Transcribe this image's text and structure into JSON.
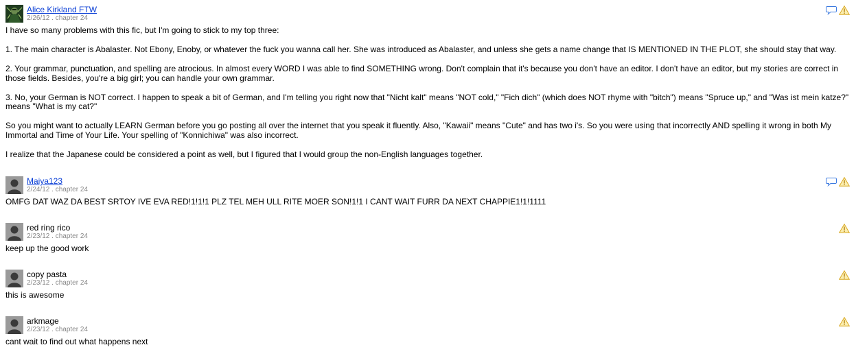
{
  "reviews": [
    {
      "author": "Alice Kirkland FTW",
      "meta": "2/26/12 . chapter 24",
      "paragraphs": [
        "I have so many problems with this fic, but I'm going to stick to my top three:",
        "1. The main character is Abalaster. Not Ebony, Enoby, or whatever the fuck you wanna call her. She was introduced as Abalaster, and unless she gets a name change that IS MENTIONED IN THE PLOT, she should stay that way.",
        "2. Your grammar, punctuation, and spelling are atrocious. In almost every WORD I was able to find SOMETHING wrong. Don't complain that it's because you don't have an editor. I don't have an editor, but my stories are correct in those fields. Besides, you're a big girl; you can handle your own grammar.",
        "3. No, your German is NOT correct. I happen to speak a bit of German, and I'm telling you right now that \"Nicht kalt\" means \"NOT cold,\" \"Fich dich\" (which does NOT rhyme with \"bitch\") means \"Spruce up,\" and \"Was ist mein katze?\" means \"What is my cat?\"",
        "So you might want to actually LEARN German before you go posting all over the internet that you speak it fluently. Also, \"Kawaii\" means \"Cute\" and has two i's. So you were using that incorrectly AND spelling it wrong in both My Immortal and Time of Your Life. Your spelling of \"Konnichiwa\" was also incorrect.",
        "I realize that the Japanese could be considered a point as well, but I figured that I would group the non-English languages together."
      ]
    },
    {
      "author": "Maiya123",
      "meta": "2/24/12 . chapter 24",
      "paragraphs": [
        "OMFG DAT WAZ DA BEST SRTOY IVE EVA RED!1!1!1 PLZ TEL MEH ULL RITE MOER SON!1!1 I CANT WAIT FURR DA NEXT CHAPPIE1!1!1111"
      ]
    },
    {
      "author": "red ring rico",
      "meta": "2/23/12 . chapter 24",
      "paragraphs": [
        "keep up the good work"
      ]
    },
    {
      "author": "copy pasta",
      "meta": "2/23/12 . chapter 24",
      "paragraphs": [
        "this is awesome"
      ]
    },
    {
      "author": "arkmage",
      "meta": "2/23/12 . chapter 24",
      "paragraphs": [
        "cant wait to find out what happens next"
      ]
    }
  ],
  "icons": {
    "reply": "reply-speech-bubble-icon",
    "report": "report-warning-triangle-icon",
    "avatar_default": "default-user-silhouette"
  },
  "colors": {
    "link": "#0b3fd6",
    "meta": "#888888",
    "reply_icon": "#3d7be0",
    "warning_icon": "#e8c33a"
  }
}
